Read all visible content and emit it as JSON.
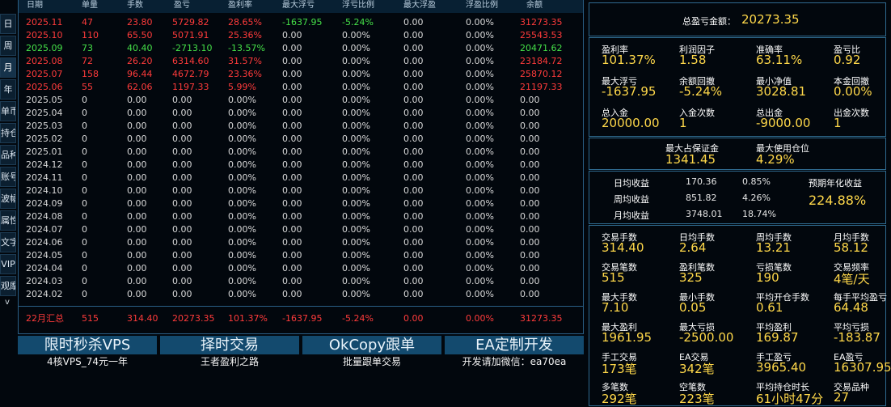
{
  "side_tabs": [
    "日",
    "周",
    "月",
    "年",
    "单币",
    "持仓",
    "品种",
    "账号",
    "波幅",
    "属性",
    "文字",
    "VIP",
    "观摩"
  ],
  "side_arrow": "v",
  "table": {
    "headers": [
      "日期",
      "单量",
      "手数",
      "盈亏",
      "盈利率",
      "最大浮亏",
      "浮亏比例",
      "最大浮盈",
      "浮盈比例",
      "余额"
    ],
    "rows": [
      {
        "color": "red",
        "cells": [
          "2025.11",
          "47",
          "23.80",
          "5729.82",
          "28.65%",
          "-1637.95",
          "-5.24%",
          "0.00",
          "0.00%",
          "31273.35"
        ]
      },
      {
        "color": "red",
        "cells": [
          "2025.10",
          "110",
          "65.50",
          "5071.91",
          "25.36%",
          "0.00",
          "0.00%",
          "0.00",
          "0.00%",
          "25543.53"
        ]
      },
      {
        "color": "green",
        "cells": [
          "2025.09",
          "73",
          "40.40",
          "-2713.10",
          "-13.57%",
          "0.00",
          "0.00%",
          "0.00",
          "0.00%",
          "20471.62"
        ]
      },
      {
        "color": "red",
        "cells": [
          "2025.08",
          "72",
          "26.20",
          "6314.60",
          "31.57%",
          "0.00",
          "0.00%",
          "0.00",
          "0.00%",
          "23184.72"
        ]
      },
      {
        "color": "red",
        "cells": [
          "2025.07",
          "158",
          "96.44",
          "4672.79",
          "23.36%",
          "0.00",
          "0.00%",
          "0.00",
          "0.00%",
          "25870.12"
        ]
      },
      {
        "color": "red",
        "cells": [
          "2025.06",
          "55",
          "62.06",
          "1197.33",
          "5.99%",
          "0.00",
          "0.00%",
          "0.00",
          "0.00%",
          "21197.33"
        ]
      },
      {
        "color": "white",
        "cells": [
          "2025.05",
          "0",
          "0.00",
          "0.00",
          "0.00%",
          "0.00",
          "0.00%",
          "0.00",
          "0.00%",
          "0.00"
        ]
      },
      {
        "color": "white",
        "cells": [
          "2025.04",
          "0",
          "0.00",
          "0.00",
          "0.00%",
          "0.00",
          "0.00%",
          "0.00",
          "0.00%",
          "0.00"
        ]
      },
      {
        "color": "white",
        "cells": [
          "2025.03",
          "0",
          "0.00",
          "0.00",
          "0.00%",
          "0.00",
          "0.00%",
          "0.00",
          "0.00%",
          "0.00"
        ]
      },
      {
        "color": "white",
        "cells": [
          "2025.02",
          "0",
          "0.00",
          "0.00",
          "0.00%",
          "0.00",
          "0.00%",
          "0.00",
          "0.00%",
          "0.00"
        ]
      },
      {
        "color": "white",
        "cells": [
          "2025.01",
          "0",
          "0.00",
          "0.00",
          "0.00%",
          "0.00",
          "0.00%",
          "0.00",
          "0.00%",
          "0.00"
        ]
      },
      {
        "color": "white",
        "cells": [
          "2024.12",
          "0",
          "0.00",
          "0.00",
          "0.00%",
          "0.00",
          "0.00%",
          "0.00",
          "0.00%",
          "0.00"
        ]
      },
      {
        "color": "white",
        "cells": [
          "2024.11",
          "0",
          "0.00",
          "0.00",
          "0.00%",
          "0.00",
          "0.00%",
          "0.00",
          "0.00%",
          "0.00"
        ]
      },
      {
        "color": "white",
        "cells": [
          "2024.10",
          "0",
          "0.00",
          "0.00",
          "0.00%",
          "0.00",
          "0.00%",
          "0.00",
          "0.00%",
          "0.00"
        ]
      },
      {
        "color": "white",
        "cells": [
          "2024.09",
          "0",
          "0.00",
          "0.00",
          "0.00%",
          "0.00",
          "0.00%",
          "0.00",
          "0.00%",
          "0.00"
        ]
      },
      {
        "color": "white",
        "cells": [
          "2024.08",
          "0",
          "0.00",
          "0.00",
          "0.00%",
          "0.00",
          "0.00%",
          "0.00",
          "0.00%",
          "0.00"
        ]
      },
      {
        "color": "white",
        "cells": [
          "2024.07",
          "0",
          "0.00",
          "0.00",
          "0.00%",
          "0.00",
          "0.00%",
          "0.00",
          "0.00%",
          "0.00"
        ]
      },
      {
        "color": "white",
        "cells": [
          "2024.06",
          "0",
          "0.00",
          "0.00",
          "0.00%",
          "0.00",
          "0.00%",
          "0.00",
          "0.00%",
          "0.00"
        ]
      },
      {
        "color": "white",
        "cells": [
          "2024.05",
          "0",
          "0.00",
          "0.00",
          "0.00%",
          "0.00",
          "0.00%",
          "0.00",
          "0.00%",
          "0.00"
        ]
      },
      {
        "color": "white",
        "cells": [
          "2024.04",
          "0",
          "0.00",
          "0.00",
          "0.00%",
          "0.00",
          "0.00%",
          "0.00",
          "0.00%",
          "0.00"
        ]
      },
      {
        "color": "white",
        "cells": [
          "2024.03",
          "0",
          "0.00",
          "0.00",
          "0.00%",
          "0.00",
          "0.00%",
          "0.00",
          "0.00%",
          "0.00"
        ]
      },
      {
        "color": "white",
        "cells": [
          "2024.02",
          "0",
          "0.00",
          "0.00",
          "0.00%",
          "0.00",
          "0.00%",
          "0.00",
          "0.00%",
          "0.00"
        ]
      }
    ],
    "summary": {
      "color": "red",
      "cells": [
        "22月汇总",
        "515",
        "314.40",
        "20273.35",
        "101.37%",
        "-1637.95",
        "-5.24%",
        "0.00",
        "0.00%",
        "31273.35"
      ]
    }
  },
  "promos": [
    {
      "title": "限时秒杀VPS",
      "sub": "4核VPS_74元一年"
    },
    {
      "title": "择时交易",
      "sub": "王者盈利之路"
    },
    {
      "title": "OkCopy跟单",
      "sub": "批量跟单交易"
    },
    {
      "title": "EA定制开发",
      "sub": "开发请加微信：ea70ea"
    }
  ],
  "stats": {
    "total_label": "总盈亏金额：",
    "total_value": "20273.35",
    "grid1": [
      {
        "label": "盈利率",
        "value": "101.37%"
      },
      {
        "label": "利润因子",
        "value": "1.58"
      },
      {
        "label": "准确率",
        "value": "63.11%"
      },
      {
        "label": "盈亏比",
        "value": "0.92"
      },
      {
        "label": "最大浮亏",
        "value": "-1637.95"
      },
      {
        "label": "余额回撤",
        "value": "-5.24%"
      },
      {
        "label": "最小净值",
        "value": "3028.81"
      },
      {
        "label": "本金回撤",
        "value": "0.00%"
      },
      {
        "label": "总入金",
        "value": "20000.00"
      },
      {
        "label": "入金次数",
        "value": "1"
      },
      {
        "label": "总出金",
        "value": "-9000.00"
      },
      {
        "label": "出金次数",
        "value": "1"
      }
    ],
    "margin": [
      {
        "label": "最大占保证金",
        "value": "1341.45"
      },
      {
        "label": "最大使用仓位",
        "value": "4.29%"
      }
    ],
    "returns": [
      {
        "label": "日均收益",
        "amount": "170.36",
        "pct": "0.85%"
      },
      {
        "label": "周均收益",
        "amount": "851.82",
        "pct": "4.26%"
      },
      {
        "label": "月均收益",
        "amount": "3748.01",
        "pct": "18.74%"
      }
    ],
    "annual_label": "预期年化收益",
    "annual_value": "224.88%",
    "grid2": [
      {
        "label": "交易手数",
        "value": "314.40"
      },
      {
        "label": "日均手数",
        "value": "2.64"
      },
      {
        "label": "周均手数",
        "value": "13.21"
      },
      {
        "label": "月均手数",
        "value": "58.12"
      },
      {
        "label": "交易笔数",
        "value": "515"
      },
      {
        "label": "盈利笔数",
        "value": "325"
      },
      {
        "label": "亏损笔数",
        "value": "190"
      },
      {
        "label": "交易频率",
        "value": "4笔/天"
      },
      {
        "label": "最大手数",
        "value": "7.10"
      },
      {
        "label": "最小手数",
        "value": "0.05"
      },
      {
        "label": "平均开仓手数",
        "value": "0.61"
      },
      {
        "label": "每手平均盈亏",
        "value": "64.48"
      },
      {
        "label": "最大盈利",
        "value": "1961.95"
      },
      {
        "label": "最大亏损",
        "value": "-2500.00"
      },
      {
        "label": "平均盈利",
        "value": "169.87"
      },
      {
        "label": "平均亏损",
        "value": "-183.87"
      },
      {
        "label": "手工交易",
        "value": "173笔"
      },
      {
        "label": "EA交易",
        "value": "342笔"
      },
      {
        "label": "手工盈亏",
        "value": "3965.40"
      },
      {
        "label": "EA盈亏",
        "value": "16307.95"
      },
      {
        "label": "多笔数",
        "value": "292笔"
      },
      {
        "label": "空笔数",
        "value": "223笔"
      },
      {
        "label": "平均持仓时长",
        "value": "61小时47分"
      },
      {
        "label": "交易品种",
        "value": "27"
      }
    ]
  }
}
